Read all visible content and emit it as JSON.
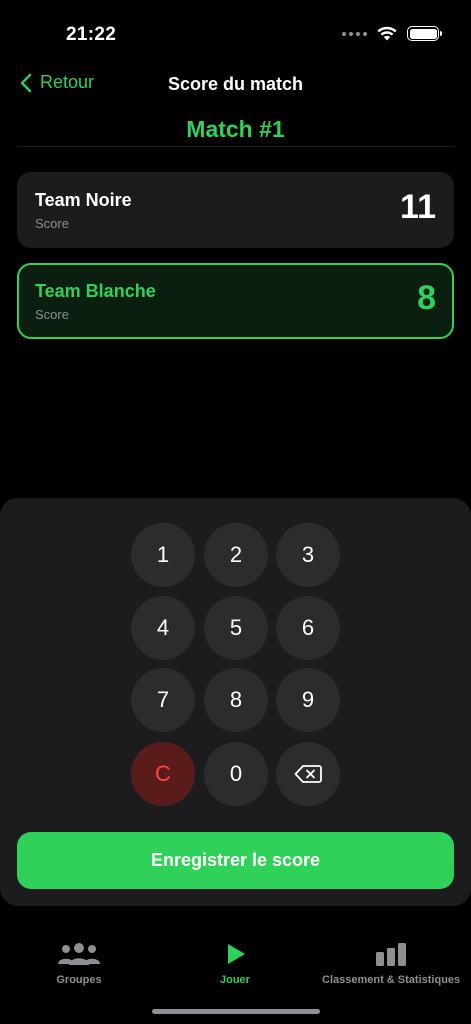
{
  "status": {
    "time": "21:22"
  },
  "nav": {
    "back_label": "Retour",
    "title": "Score du match"
  },
  "match": {
    "title": "Match #1"
  },
  "teams": [
    {
      "name": "Team Noire",
      "subtitle": "Score",
      "score": "11"
    },
    {
      "name": "Team Blanche",
      "subtitle": "Score",
      "score": "8"
    }
  ],
  "keypad": {
    "keys": [
      "1",
      "2",
      "3",
      "4",
      "5",
      "6",
      "7",
      "8",
      "9",
      "C",
      "0"
    ]
  },
  "save_button": {
    "label": "Enregistrer le score"
  },
  "tabs": [
    {
      "label": "Groupes",
      "icon": "people-icon"
    },
    {
      "label": "Jouer",
      "icon": "play-icon"
    },
    {
      "label": "Classement & Statistiques",
      "icon": "bar-chart-icon"
    }
  ],
  "colors": {
    "accent": "#30d158",
    "clear_text": "#ff453a",
    "card": "#1c1c1e",
    "key": "#2c2c2e"
  }
}
